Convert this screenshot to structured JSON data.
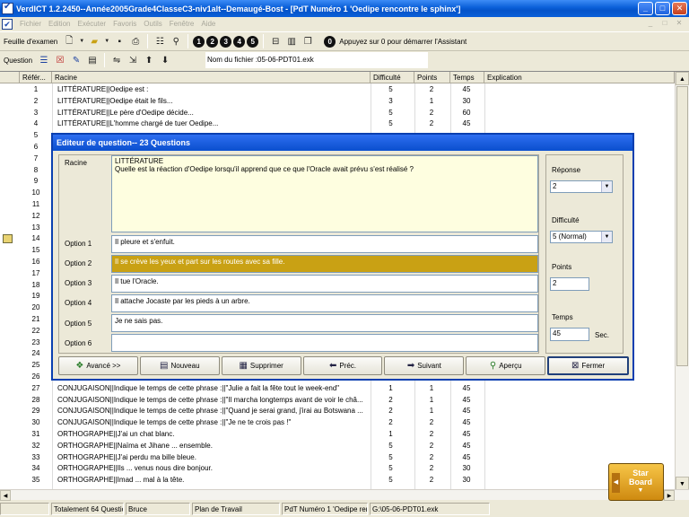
{
  "window": {
    "title": "VerdICT 1.2.2450--Année2005Grade4ClasseC3-niv1alt--Demaugé-Bost - [PdT Numéro 1 'Oedipe rencontre le sphinx']",
    "minimize_glyph": "_",
    "maximize_glyph": "□",
    "close_glyph": "✕"
  },
  "menu": {
    "items": [
      "Fichier",
      "Edition",
      "Exécuter",
      "Favoris",
      "Outils",
      "Fenêtre",
      "Aide"
    ],
    "mdi_buttons": [
      "_",
      "□",
      "✕"
    ]
  },
  "toolbar1": {
    "label": "Feuille d'examen",
    "icons": [
      "new-sheet-icon",
      "open-folder-icon",
      "save-icon",
      "print-icon",
      "properties-icon",
      "find-icon"
    ],
    "numbers": [
      "1",
      "2",
      "3",
      "4",
      "5"
    ],
    "hint_number": "0",
    "hint": "Appuyez sur 0 pour démarrer l'Assistant"
  },
  "toolbar2": {
    "label": "Question",
    "file": "Nom du fichier :05-06-PDT01.exk"
  },
  "grid": {
    "headers": [
      "Référ...",
      "Racine",
      "Difficulté",
      "Points",
      "Temps",
      "Explication"
    ],
    "rows": [
      {
        "n": "1",
        "racine": "LITTÉRATURE||Oedipe est :",
        "dif": "5",
        "pts": "2",
        "tps": "45"
      },
      {
        "n": "2",
        "racine": "LITTÉRATURE||Oedipe était le fils...",
        "dif": "3",
        "pts": "1",
        "tps": "30"
      },
      {
        "n": "3",
        "racine": "LITTÉRATURE||Le père d'Oedipe décide...",
        "dif": "5",
        "pts": "2",
        "tps": "60"
      },
      {
        "n": "4",
        "racine": "LITTÉRATURE||L'homme chargé de tuer Oedipe...",
        "dif": "5",
        "pts": "2",
        "tps": "45"
      },
      {
        "n": "5",
        "racine": "",
        "dif": "",
        "pts": "",
        "tps": ""
      },
      {
        "n": "6",
        "racine": "",
        "dif": "",
        "pts": "",
        "tps": ""
      },
      {
        "n": "7",
        "racine": "",
        "dif": "",
        "pts": "",
        "tps": ""
      },
      {
        "n": "8",
        "racine": "",
        "dif": "",
        "pts": "",
        "tps": ""
      },
      {
        "n": "9",
        "racine": "",
        "dif": "",
        "pts": "",
        "tps": ""
      },
      {
        "n": "10",
        "racine": "",
        "dif": "",
        "pts": "",
        "tps": ""
      },
      {
        "n": "11",
        "racine": "",
        "dif": "",
        "pts": "",
        "tps": ""
      },
      {
        "n": "12",
        "racine": "",
        "dif": "",
        "pts": "",
        "tps": ""
      },
      {
        "n": "13",
        "racine": "",
        "dif": "",
        "pts": "",
        "tps": ""
      },
      {
        "n": "14",
        "racine": "",
        "dif": "",
        "pts": "",
        "tps": ""
      },
      {
        "n": "15",
        "racine": "",
        "dif": "",
        "pts": "",
        "tps": ""
      },
      {
        "n": "16",
        "racine": "",
        "dif": "",
        "pts": "",
        "tps": ""
      },
      {
        "n": "17",
        "racine": "",
        "dif": "",
        "pts": "",
        "tps": ""
      },
      {
        "n": "18",
        "racine": "",
        "dif": "",
        "pts": "",
        "tps": ""
      },
      {
        "n": "19",
        "racine": "",
        "dif": "",
        "pts": "",
        "tps": ""
      },
      {
        "n": "20",
        "racine": "",
        "dif": "",
        "pts": "",
        "tps": ""
      },
      {
        "n": "21",
        "racine": "",
        "dif": "",
        "pts": "",
        "tps": ""
      },
      {
        "n": "22",
        "racine": "",
        "dif": "",
        "pts": "",
        "tps": ""
      },
      {
        "n": "23",
        "racine": "",
        "dif": "",
        "pts": "",
        "tps": ""
      },
      {
        "n": "24",
        "racine": "",
        "dif": "",
        "pts": "",
        "tps": ""
      },
      {
        "n": "25",
        "racine": "",
        "dif": "",
        "pts": "",
        "tps": ""
      },
      {
        "n": "26",
        "racine": "",
        "dif": "",
        "pts": "",
        "tps": ""
      },
      {
        "n": "27",
        "racine": "CONJUGAISON||Indique le temps de cette phrase :||\"Julie a fait la fête tout le week-end\"",
        "dif": "1",
        "pts": "1",
        "tps": "45"
      },
      {
        "n": "28",
        "racine": "CONJUGAISON||Indique le temps de cette phrase :||\"Il marcha longtemps avant de voir le châ...",
        "dif": "2",
        "pts": "1",
        "tps": "45"
      },
      {
        "n": "29",
        "racine": "CONJUGAISON||Indique le temps de cette phrase :||\"Quand je serai grand, j'irai au Botswana ...",
        "dif": "2",
        "pts": "1",
        "tps": "45"
      },
      {
        "n": "30",
        "racine": "CONJUGAISON||Indique le temps de cette phrase :||\"Je ne te crois pas !\"",
        "dif": "2",
        "pts": "2",
        "tps": "45"
      },
      {
        "n": "31",
        "racine": "ORTHOGRAPHE||J'ai un chat blanc.",
        "dif": "1",
        "pts": "2",
        "tps": "45"
      },
      {
        "n": "32",
        "racine": "ORTHOGRAPHE||Naïma et Jihane ... ensemble.",
        "dif": "5",
        "pts": "2",
        "tps": "45"
      },
      {
        "n": "33",
        "racine": "ORTHOGRAPHE||J'ai perdu ma bille bleue.",
        "dif": "5",
        "pts": "2",
        "tps": "45"
      },
      {
        "n": "34",
        "racine": "ORTHOGRAPHE||Ils ... venus nous dire bonjour.",
        "dif": "5",
        "pts": "2",
        "tps": "30"
      },
      {
        "n": "35",
        "racine": "ORTHOGRAPHE||Imad ... mal à la tête.",
        "dif": "5",
        "pts": "2",
        "tps": "30"
      }
    ]
  },
  "dialog": {
    "title": "Editeur de question-- 23 Questions",
    "racine_label": "Racine",
    "racine_line1": "LITTÉRATURE",
    "racine_line2": "Quelle est la réaction d'Oedipe lorsqu'il apprend que ce que l'Oracle avait prévu s'est réalisé ?",
    "options": [
      {
        "label": "Option 1",
        "value": "Il pleure et s'enfuit."
      },
      {
        "label": "Option 2",
        "value": "Il se crève les yeux et part sur les routes avec sa fille."
      },
      {
        "label": "Option 3",
        "value": "Il tue l'Oracle."
      },
      {
        "label": "Option 4",
        "value": "Il attache Jocaste par les pieds à un arbre."
      },
      {
        "label": "Option 5",
        "value": "Je ne sais pas."
      },
      {
        "label": "Option 6",
        "value": ""
      }
    ],
    "selected_option": 2,
    "reponse_label": "Réponse",
    "reponse_value": "2",
    "difficulte_label": "Difficulté",
    "difficulte_value": "5 (Normal)",
    "points_label": "Points",
    "points_value": "2",
    "temps_label": "Temps",
    "temps_value": "45",
    "temps_unit": "Sec.",
    "buttons": {
      "avance": "Avancé >>",
      "nouveau": "Nouveau",
      "supprimer": "Supprimer",
      "prec": "Préc.",
      "suivant": "Suivant",
      "apercu": "Aperçu",
      "fermer": "Fermer"
    },
    "accent": "#c9a114"
  },
  "status": {
    "total": "Totalement 64 Questio",
    "user": "Bruce",
    "mode": "Plan de Travail",
    "pdt": "PdT Numéro 1 'Oedipe rer",
    "path": "G:\\05-06-PDT01.exk"
  },
  "starboard": {
    "line1": "Star",
    "line2": "Board"
  }
}
